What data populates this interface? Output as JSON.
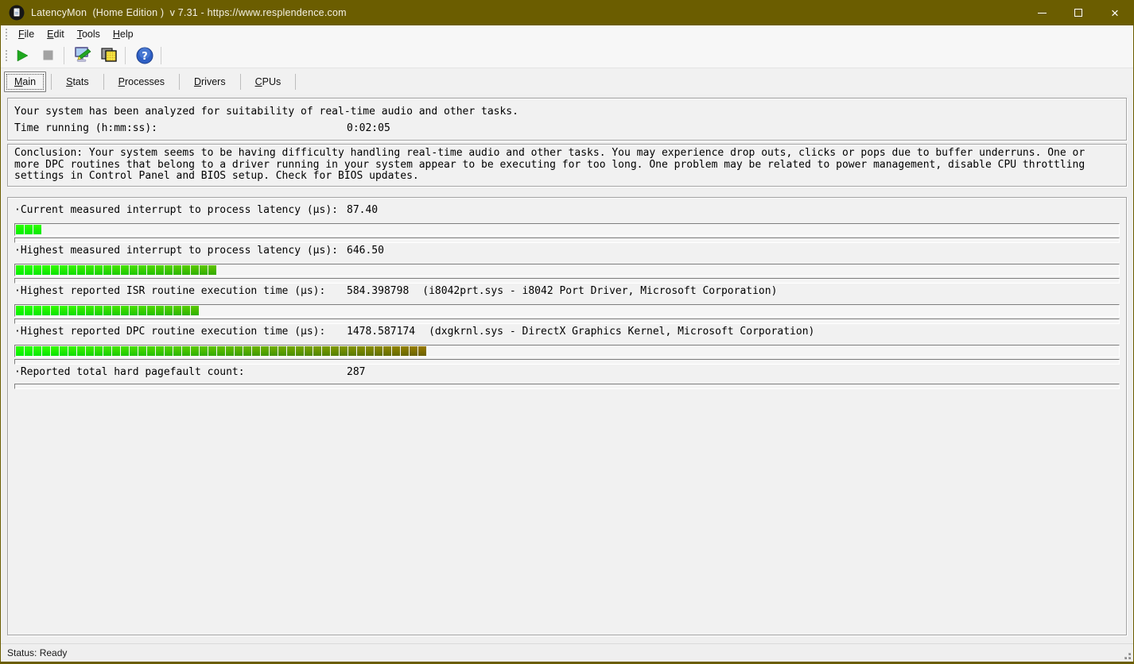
{
  "window": {
    "title": "LatencyMon  (Home Edition )  v 7.31 - https://www.resplendence.com",
    "close_glyph": "×"
  },
  "menu": {
    "items": [
      {
        "accel": "F",
        "rest": "ile"
      },
      {
        "accel": "E",
        "rest": "dit"
      },
      {
        "accel": "T",
        "rest": "ools"
      },
      {
        "accel": "H",
        "rest": "elp"
      }
    ]
  },
  "toolbar": {
    "buttons": [
      {
        "icon": "play-icon"
      },
      {
        "icon": "stop-icon"
      },
      {
        "icon": "analyze-report-icon"
      },
      {
        "icon": "processes-icon"
      },
      {
        "icon": "help-icon"
      }
    ]
  },
  "tabs": [
    {
      "accel": "M",
      "rest": "ain",
      "active": true
    },
    {
      "accel": "S",
      "rest": "tats",
      "active": false
    },
    {
      "accel": "P",
      "rest": "rocesses",
      "active": false
    },
    {
      "accel": "D",
      "rest": "rivers",
      "active": false
    },
    {
      "accel": "C",
      "rest": "PUs",
      "active": false
    }
  ],
  "analysis": {
    "line1": "Your system has been analyzed for suitability of real-time audio and other tasks.",
    "time_label": "Time running (h:mm:ss):",
    "time_value": "0:02:05"
  },
  "conclusion": {
    "lines": [
      "Conclusion: Your system seems to be having difficulty handling real-time audio and other tasks. You may experience drop outs, clicks or pops due to buffer underruns. One or",
      "more DPC routines that belong to a driver running in your system appear to be executing for too long. One problem may be related to power management, disable CPU throttling",
      "settings in Control Panel and BIOS setup. Check for BIOS updates."
    ]
  },
  "measurements": {
    "gradient_span_segments": 47,
    "rows": [
      {
        "label": "·Current measured interrupt to process latency (µs):",
        "value": "87.40",
        "info": "",
        "segments": 3,
        "has_bar": true
      },
      {
        "label": "·Highest measured interrupt to process latency (µs):",
        "value": "646.50",
        "info": "",
        "segments": 23,
        "has_bar": true
      },
      {
        "label": "·Highest reported ISR routine execution time (µs):",
        "value": "584.398798",
        "info": "(i8042prt.sys - i8042 Port Driver, Microsoft Corporation)",
        "segments": 21,
        "has_bar": true
      },
      {
        "label": "·Highest reported DPC routine execution time (µs):",
        "value": "1478.587174",
        "info": "(dxgkrnl.sys - DirectX Graphics Kernel, Microsoft Corporation)",
        "segments": 47,
        "has_bar": true
      },
      {
        "label": "·Reported total hard pagefault count:",
        "value": "287",
        "info": "",
        "segments": 0,
        "has_bar": false
      }
    ]
  },
  "status": {
    "text": "Status: Ready"
  },
  "colors": {
    "titlebar": "#6b5d00",
    "bar_gradient_start": "#00ee00",
    "bar_gradient_end": "#6b6100",
    "play": "#1fa81f",
    "stop_disabled": "#a2a2a2",
    "help_blue": "#3a6ad0"
  }
}
